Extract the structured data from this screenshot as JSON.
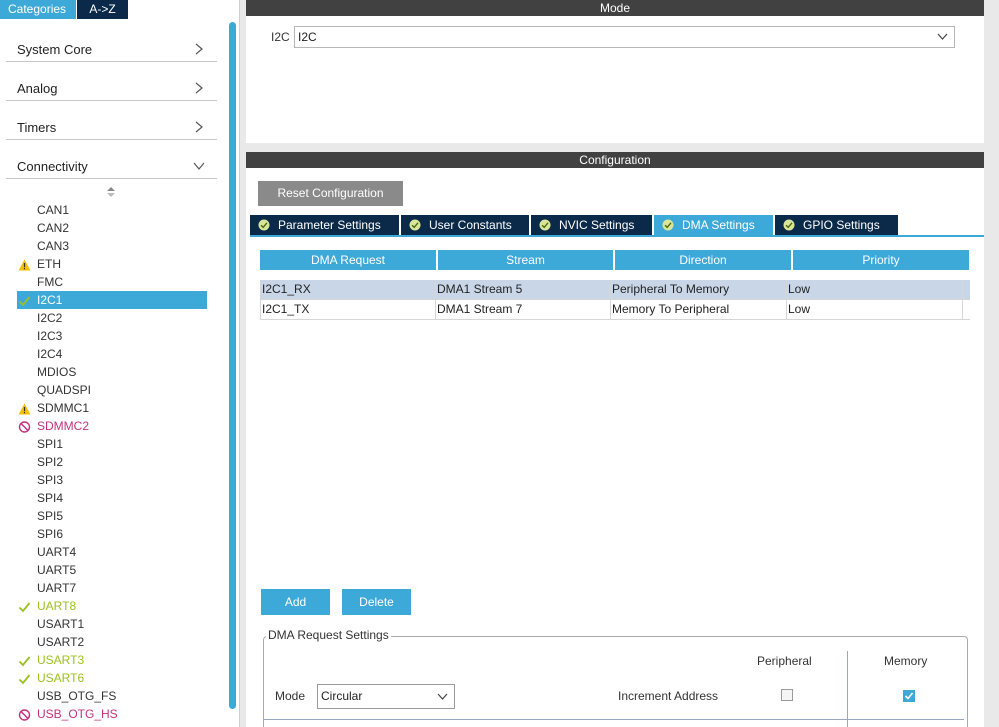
{
  "left": {
    "tabs": {
      "categories": "Categories",
      "az": "A->Z"
    },
    "categories": [
      {
        "label": "System Core",
        "expanded": false
      },
      {
        "label": "Analog",
        "expanded": false
      },
      {
        "label": "Timers",
        "expanded": false
      },
      {
        "label": "Connectivity",
        "expanded": true
      }
    ],
    "peripherals": [
      {
        "label": "CAN1",
        "status": "none"
      },
      {
        "label": "CAN2",
        "status": "none"
      },
      {
        "label": "CAN3",
        "status": "none"
      },
      {
        "label": "ETH",
        "status": "warning"
      },
      {
        "label": "FMC",
        "status": "none"
      },
      {
        "label": "I2C1",
        "status": "ok",
        "selected": true
      },
      {
        "label": "I2C2",
        "status": "none"
      },
      {
        "label": "I2C3",
        "status": "none"
      },
      {
        "label": "I2C4",
        "status": "none"
      },
      {
        "label": "MDIOS",
        "status": "none"
      },
      {
        "label": "QUADSPI",
        "status": "none"
      },
      {
        "label": "SDMMC1",
        "status": "warning"
      },
      {
        "label": "SDMMC2",
        "status": "blocked"
      },
      {
        "label": "SPI1",
        "status": "none"
      },
      {
        "label": "SPI2",
        "status": "none"
      },
      {
        "label": "SPI3",
        "status": "none"
      },
      {
        "label": "SPI4",
        "status": "none"
      },
      {
        "label": "SPI5",
        "status": "none"
      },
      {
        "label": "SPI6",
        "status": "none"
      },
      {
        "label": "UART4",
        "status": "none"
      },
      {
        "label": "UART5",
        "status": "none"
      },
      {
        "label": "UART7",
        "status": "none"
      },
      {
        "label": "UART8",
        "status": "ok"
      },
      {
        "label": "USART1",
        "status": "none"
      },
      {
        "label": "USART2",
        "status": "none"
      },
      {
        "label": "USART3",
        "status": "ok"
      },
      {
        "label": "USART6",
        "status": "ok"
      },
      {
        "label": "USB_OTG_FS",
        "status": "none"
      },
      {
        "label": "USB_OTG_HS",
        "status": "blocked"
      }
    ]
  },
  "mode": {
    "header": "Mode",
    "label": "I2C",
    "value": "I2C"
  },
  "config": {
    "header": "Configuration",
    "reset_label": "Reset Configuration",
    "tabs": [
      {
        "label": "Parameter Settings",
        "active": false
      },
      {
        "label": "User Constants",
        "active": false
      },
      {
        "label": "NVIC Settings",
        "active": false
      },
      {
        "label": "DMA Settings",
        "active": true
      },
      {
        "label": "GPIO Settings",
        "active": false
      }
    ],
    "table": {
      "columns": [
        "DMA Request",
        "Stream",
        "Direction",
        "Priority"
      ],
      "rows": [
        {
          "cells": [
            "I2C1_RX",
            "DMA1 Stream 5",
            "Peripheral To Memory",
            "Low"
          ],
          "selected": true
        },
        {
          "cells": [
            "I2C1_TX",
            "DMA1 Stream 7",
            "Memory To Peripheral",
            "Low"
          ],
          "selected": false
        }
      ]
    },
    "add_label": "Add",
    "delete_label": "Delete",
    "request_settings": {
      "title": "DMA Request Settings",
      "peripheral_label": "Peripheral",
      "memory_label": "Memory",
      "mode_label": "Mode",
      "mode_value": "Circular",
      "increment_label": "Increment Address",
      "increment_peripheral": false,
      "increment_memory": true
    }
  },
  "colors": {
    "accent": "#3da9d9",
    "dark_navy": "#0b2a4a",
    "ok_green": "#9ac21f",
    "warning_yellow": "#f2c200",
    "blocked_magenta": "#c3317f"
  }
}
